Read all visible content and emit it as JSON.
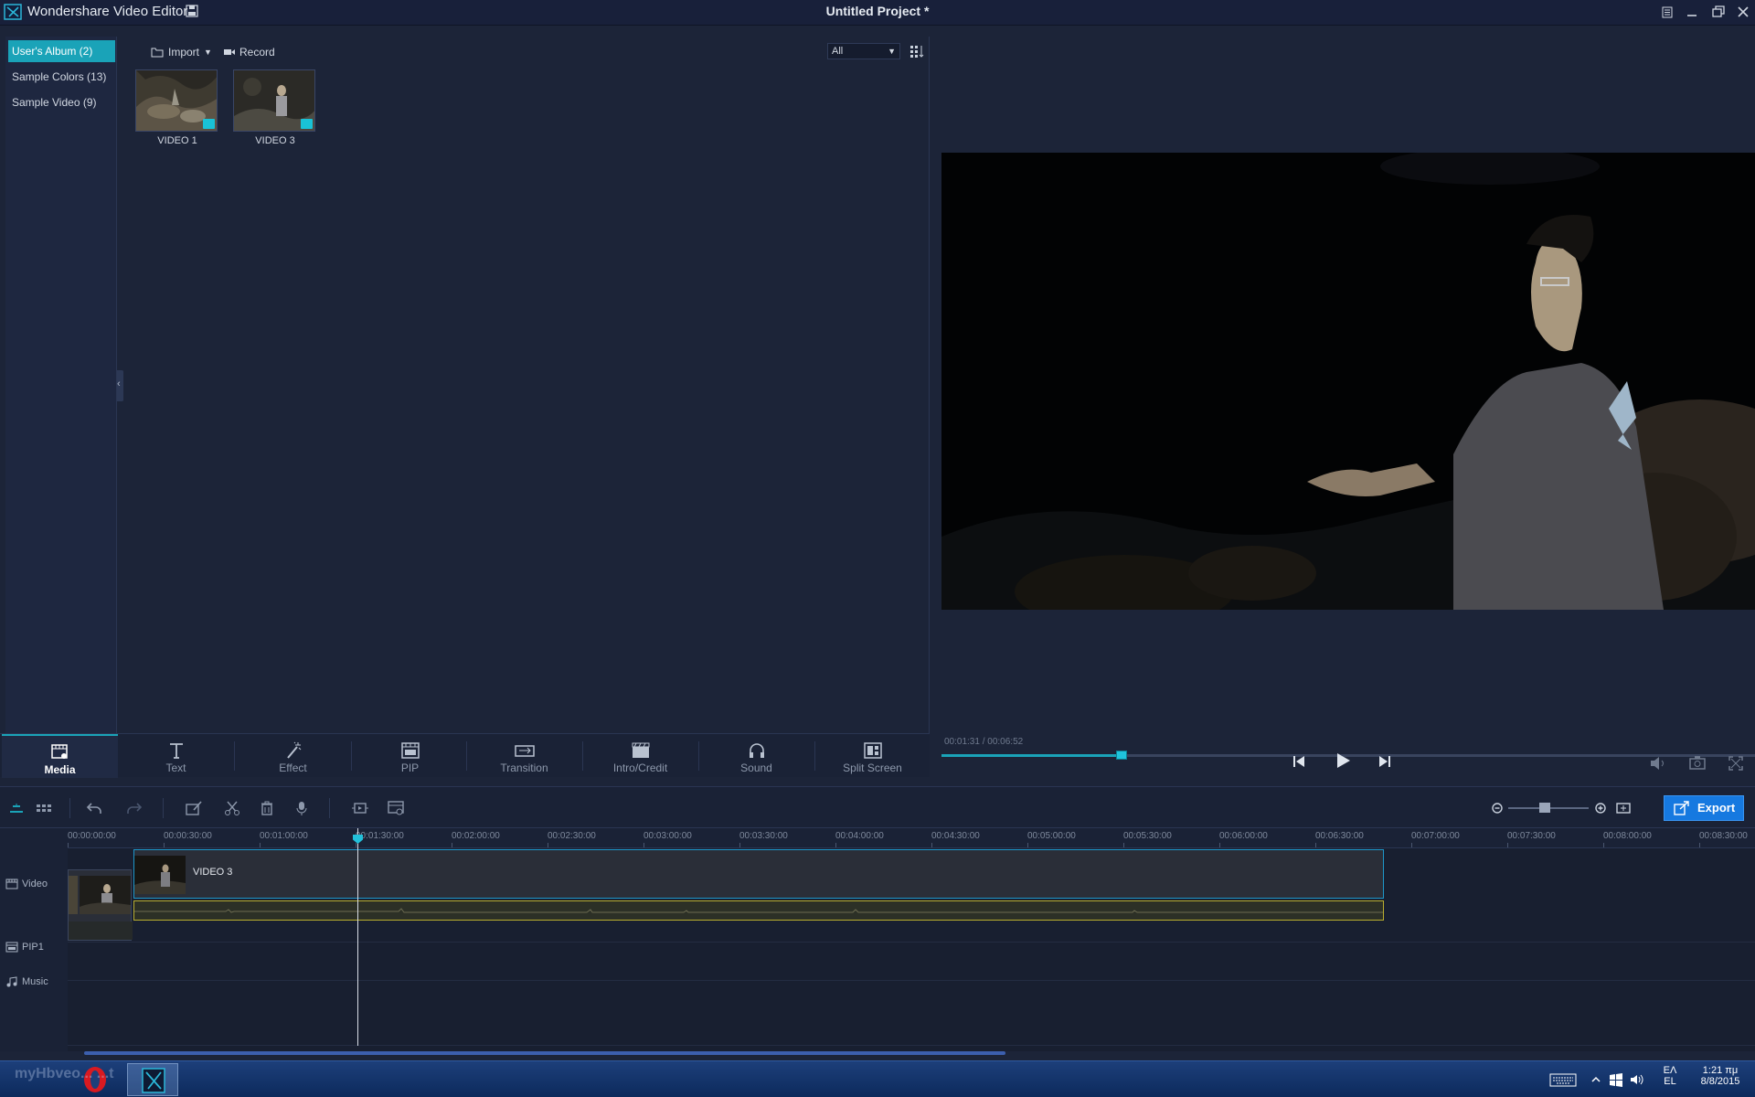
{
  "app": {
    "title": "Wondershare Video Editor",
    "project_title": "Untitled Project *"
  },
  "albums": [
    {
      "label": "User's Album (2)",
      "active": true
    },
    {
      "label": "Sample Colors (13)",
      "active": false
    },
    {
      "label": "Sample Video (9)",
      "active": false
    }
  ],
  "media_toolbar": {
    "import_label": "Import",
    "record_label": "Record",
    "filter_value": "All"
  },
  "media_items": [
    {
      "label": "VIDEO 1"
    },
    {
      "label": "VIDEO 3"
    }
  ],
  "tabs": [
    {
      "label": "Media",
      "icon": "media-icon",
      "active": true
    },
    {
      "label": "Text",
      "icon": "text-icon",
      "active": false
    },
    {
      "label": "Effect",
      "icon": "effect-wand-icon",
      "active": false
    },
    {
      "label": "PIP",
      "icon": "pip-icon",
      "active": false
    },
    {
      "label": "Transition",
      "icon": "transition-icon",
      "active": false
    },
    {
      "label": "Intro/Credit",
      "icon": "clapperboard-icon",
      "active": false
    },
    {
      "label": "Sound",
      "icon": "headphones-icon",
      "active": false
    },
    {
      "label": "Split Screen",
      "icon": "split-screen-icon",
      "active": false
    }
  ],
  "preview": {
    "time_readout": "00:01:31 / 00:06:52",
    "progress_fraction": 0.221
  },
  "timeline": {
    "ruler_ticks": [
      "00:00:00:00",
      "00:00:30:00",
      "00:01:00:00",
      "00:01:30:00",
      "00:02:00:00",
      "00:02:30:00",
      "00:03:00:00",
      "00:03:30:00",
      "00:04:00:00",
      "00:04:30:00",
      "00:05:00:00",
      "00:05:30:00",
      "00:06:00:00",
      "00:06:30:00",
      "00:07:00:00",
      "00:07:30:00",
      "00:08:00:00",
      "00:08:30:00"
    ],
    "tracks": [
      {
        "label": "Video",
        "icon": "film-track-icon"
      },
      {
        "label": "PIP1",
        "icon": "pip-track-icon"
      },
      {
        "label": "Music",
        "icon": "music-note-icon"
      }
    ],
    "clip_name": "VIDEO 3",
    "export_label": "Export"
  },
  "taskbar": {
    "language_top": "ΕΛ",
    "language_bottom": "EL",
    "clock_time": "1:21 πμ",
    "clock_date": "8/8/2015",
    "watermark": "myHbveo... ...t"
  },
  "colors": {
    "accent": "#1aa3b8",
    "export": "#1679e0",
    "background": "#1c2438"
  }
}
